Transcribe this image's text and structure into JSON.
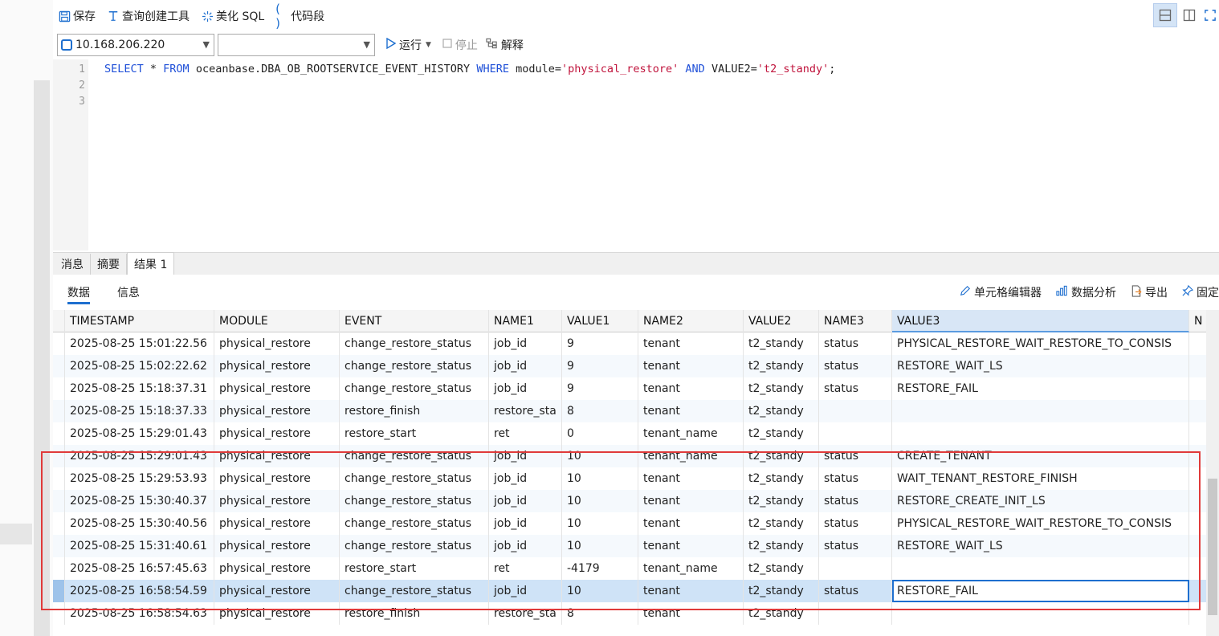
{
  "toolbar": {
    "save": "保存",
    "query_builder": "查询创建工具",
    "beautify": "美化 SQL",
    "snippet": "代码段"
  },
  "connection": {
    "host": "10.168.206.220",
    "database": "",
    "run": "运行",
    "stop": "停止",
    "explain": "解释"
  },
  "editor": {
    "line_numbers": [
      "1",
      "2",
      "3"
    ],
    "sql": {
      "select": "SELECT",
      "star": " * ",
      "from": "FROM",
      "table": " oceanbase.DBA_OB_ROOTSERVICE_EVENT_HISTORY ",
      "where": "WHERE",
      "col1": " module=",
      "val1": "'physical_restore'",
      "and": " AND ",
      "col2": "VALUE2=",
      "val2": "'t2_standy'",
      "end": ";"
    }
  },
  "result_tabs": [
    "消息",
    "摘要",
    "结果 1"
  ],
  "sub_tabs": [
    "数据",
    "信息"
  ],
  "actions": {
    "cell_editor": "单元格编辑器",
    "analysis": "数据分析",
    "export": "导出",
    "pin": "固定"
  },
  "grid": {
    "columns": [
      "TIMESTAMP",
      "MODULE",
      "EVENT",
      "NAME1",
      "VALUE1",
      "NAME2",
      "VALUE2",
      "NAME3",
      "VALUE3",
      "N"
    ],
    "rows": [
      [
        "2025-08-25 15:01:22.56",
        "physical_restore",
        "change_restore_status",
        "job_id",
        "9",
        "tenant",
        "t2_standy",
        "status",
        "PHYSICAL_RESTORE_WAIT_RESTORE_TO_CONSIS"
      ],
      [
        "2025-08-25 15:02:22.62",
        "physical_restore",
        "change_restore_status",
        "job_id",
        "9",
        "tenant",
        "t2_standy",
        "status",
        "RESTORE_WAIT_LS"
      ],
      [
        "2025-08-25 15:18:37.31",
        "physical_restore",
        "change_restore_status",
        "job_id",
        "9",
        "tenant",
        "t2_standy",
        "status",
        "RESTORE_FAIL"
      ],
      [
        "2025-08-25 15:18:37.33",
        "physical_restore",
        "restore_finish",
        "restore_sta",
        "8",
        "tenant",
        "t2_standy",
        "",
        ""
      ],
      [
        "2025-08-25 15:29:01.43",
        "physical_restore",
        "restore_start",
        "ret",
        "0",
        "tenant_name",
        "t2_standy",
        "",
        ""
      ],
      [
        "2025-08-25 15:29:01.43",
        "physical_restore",
        "change_restore_status",
        "job_id",
        "10",
        "tenant_name",
        "t2_standy",
        "status",
        "CREATE_TENANT"
      ],
      [
        "2025-08-25 15:29:53.93",
        "physical_restore",
        "change_restore_status",
        "job_id",
        "10",
        "tenant",
        "t2_standy",
        "status",
        "WAIT_TENANT_RESTORE_FINISH"
      ],
      [
        "2025-08-25 15:30:40.37",
        "physical_restore",
        "change_restore_status",
        "job_id",
        "10",
        "tenant",
        "t2_standy",
        "status",
        "RESTORE_CREATE_INIT_LS"
      ],
      [
        "2025-08-25 15:30:40.56",
        "physical_restore",
        "change_restore_status",
        "job_id",
        "10",
        "tenant",
        "t2_standy",
        "status",
        "PHYSICAL_RESTORE_WAIT_RESTORE_TO_CONSIS"
      ],
      [
        "2025-08-25 15:31:40.61",
        "physical_restore",
        "change_restore_status",
        "job_id",
        "10",
        "tenant",
        "t2_standy",
        "status",
        "RESTORE_WAIT_LS"
      ],
      [
        "2025-08-25 16:57:45.63",
        "physical_restore",
        "restore_start",
        "ret",
        "-4179",
        "tenant_name",
        "t2_standy",
        "",
        ""
      ],
      [
        "2025-08-25 16:58:54.59",
        "physical_restore",
        "change_restore_status",
        "job_id",
        "10",
        "tenant",
        "t2_standy",
        "status",
        "RESTORE_FAIL"
      ],
      [
        "2025-08-25 16:58:54.63",
        "physical_restore",
        "restore_finish",
        "restore_sta",
        "8",
        "tenant",
        "t2_standy",
        "",
        ""
      ]
    ]
  },
  "colors": {
    "accent": "#1e6fcf",
    "highlight_box": "#e03a3a",
    "selected_row": "#cfe3f7"
  }
}
